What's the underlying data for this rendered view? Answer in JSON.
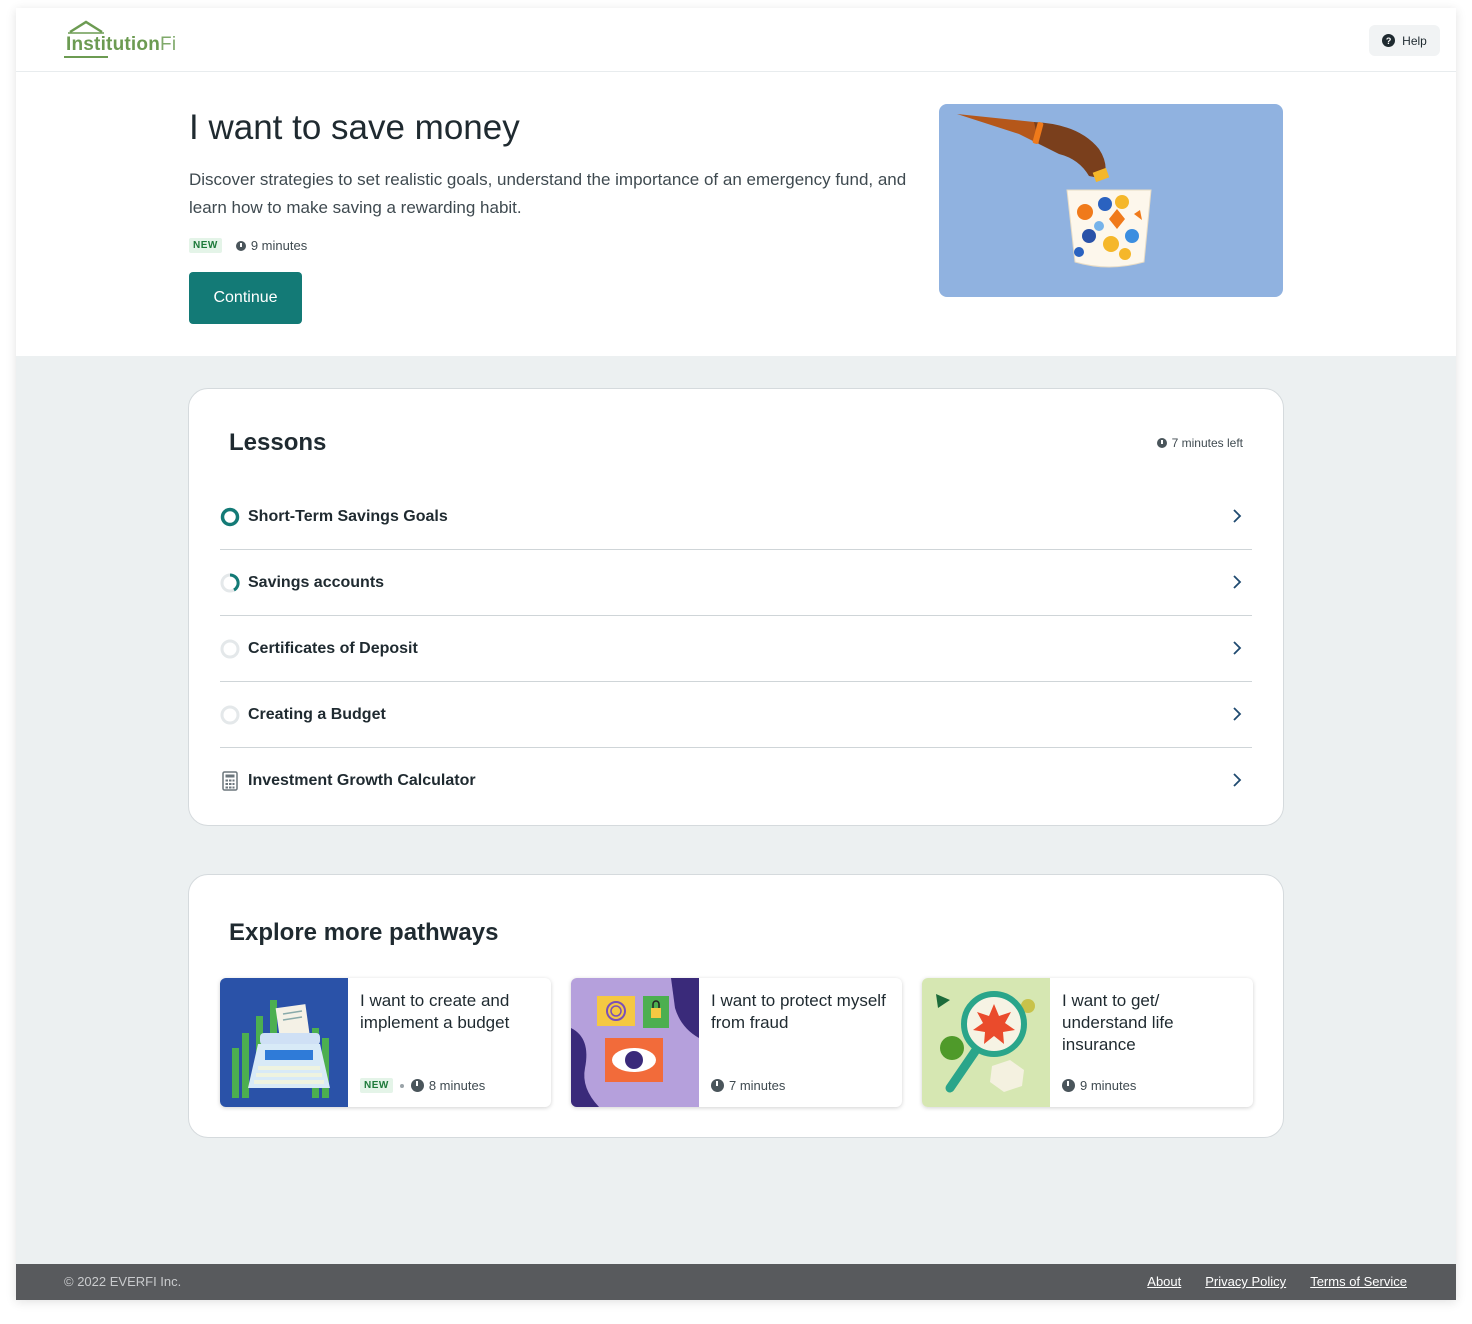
{
  "brand": {
    "name_primary": "Institution",
    "name_secondary": "Fi",
    "color": "#6c9b52"
  },
  "header": {
    "help_label": "Help",
    "help_icon": "question-circle-icon"
  },
  "hero": {
    "title": "I want to save money",
    "description": "Discover strategies to set realistic goals, understand the importance of an emergency fund, and learn how to make saving a rewarding habit.",
    "badge": "NEW",
    "duration": "9 minutes",
    "continue_label": "Continue",
    "accent_color": "#137a76"
  },
  "lessons": {
    "title": "Lessons",
    "time_left": "7 minutes left",
    "items": [
      {
        "label": "Short-Term Savings Goals",
        "status": "current",
        "icon": "ring-icon"
      },
      {
        "label": "Savings accounts",
        "status": "in-progress",
        "icon": "progress-ring-icon",
        "progress": 0.3
      },
      {
        "label": "Certificates of Deposit",
        "status": "not-started",
        "icon": "empty-ring-icon"
      },
      {
        "label": "Creating a Budget",
        "status": "not-started",
        "icon": "empty-ring-icon"
      },
      {
        "label": "Investment Growth Calculator",
        "status": "tool",
        "icon": "calculator-icon"
      }
    ]
  },
  "explore": {
    "title": "Explore more pathways",
    "cards": [
      {
        "title": "I want to create and implement a budget",
        "badge": "NEW",
        "duration": "8 minutes",
        "thumb_color": "#2a52a8"
      },
      {
        "title": "I want to protect myself from fraud",
        "badge": "",
        "duration": "7 minutes",
        "thumb_color": "#b5a0dc"
      },
      {
        "title": "I want to get/ understand life insurance",
        "badge": "",
        "duration": "9 minutes",
        "thumb_color": "#d6e7b2"
      }
    ]
  },
  "footer": {
    "copyright": "© 2022 EVERFI Inc.",
    "links": [
      "About",
      "Privacy Policy",
      "Terms of Service"
    ]
  }
}
